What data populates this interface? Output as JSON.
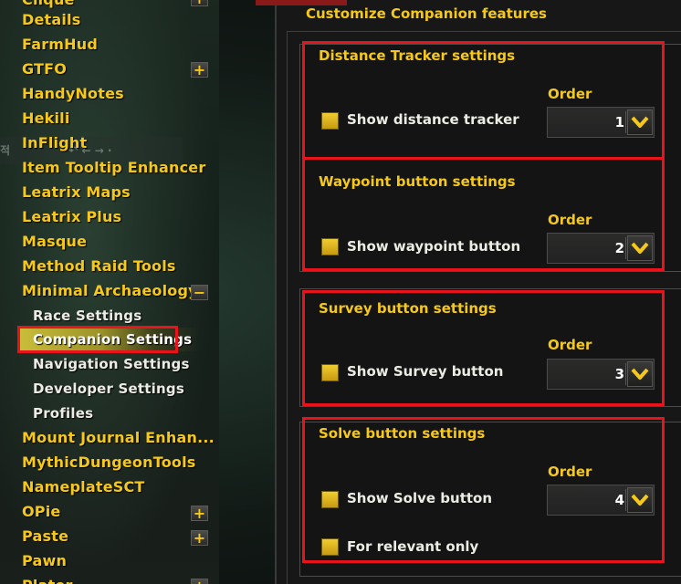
{
  "sidebar": {
    "items": [
      {
        "label": "Clique"
      },
      {
        "label": "Details"
      },
      {
        "label": "FarmHud"
      },
      {
        "label": "GTFO",
        "toggle": "+"
      },
      {
        "label": "HandyNotes"
      },
      {
        "label": "Hekili"
      },
      {
        "label": "InFlight"
      },
      {
        "label": "Item Tooltip Enhancer"
      },
      {
        "label": "Leatrix Maps"
      },
      {
        "label": "Leatrix Plus"
      },
      {
        "label": "Masque"
      },
      {
        "label": "Method Raid Tools"
      },
      {
        "label": "Minimal Archaeology",
        "toggle": "−"
      },
      {
        "label": "Race Settings"
      },
      {
        "label": "Companion Settings",
        "selected": true
      },
      {
        "label": "Navigation Settings"
      },
      {
        "label": "Developer Settings"
      },
      {
        "label": "Profiles"
      },
      {
        "label": "Mount Journal Enhan..."
      },
      {
        "label": "MythicDungeonTools"
      },
      {
        "label": "NameplateSCT"
      },
      {
        "label": "OPie",
        "toggle": "+"
      },
      {
        "label": "Paste",
        "toggle": "+"
      },
      {
        "label": "Pawn"
      },
      {
        "label": "Plater"
      }
    ],
    "stray_glyph": "적",
    "stray_icons": "↶ ← →  ·"
  },
  "panel": {
    "heading": "Customize Companion features",
    "groups": [
      {
        "title": "Distance Tracker settings",
        "order_label": "Order",
        "checkboxes": [
          {
            "label": "Show distance tracker",
            "checked": false
          }
        ],
        "order_value": "1"
      },
      {
        "title": "Waypoint button settings",
        "order_label": "Order",
        "checkboxes": [
          {
            "label": "Show waypoint button",
            "checked": false
          }
        ],
        "order_value": "2"
      },
      {
        "title": "Survey button settings",
        "order_label": "Order",
        "checkboxes": [
          {
            "label": "Show Survey button",
            "checked": false
          }
        ],
        "order_value": "3"
      },
      {
        "title": "Solve button settings",
        "order_label": "Order",
        "checkboxes": [
          {
            "label": "Show Solve button",
            "checked": false
          },
          {
            "label": "For relevant only",
            "checked": false
          }
        ],
        "order_value": "4"
      }
    ],
    "dropdown_arrow_icon": "chevron-down-icon"
  },
  "colors": {
    "accent_gold": "#f5c81a",
    "highlight_red": "#e8131b",
    "selection_bar": "#c9bd3a"
  }
}
